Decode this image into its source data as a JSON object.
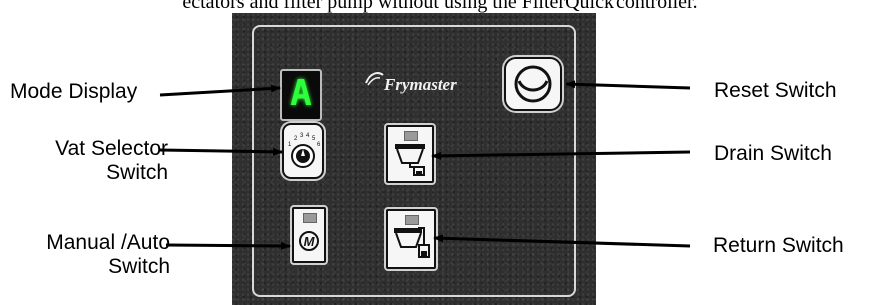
{
  "intro_text": {
    "prefix": "ectators and filter pump without using the FilterQuick",
    "suffix": "controller."
  },
  "panel": {
    "mode_display_value": "A",
    "brand": "Frymaster",
    "vat_selector_numbers": [
      "1",
      "2",
      "3",
      "4",
      "5",
      "6"
    ],
    "manual_symbol": "M"
  },
  "labels": {
    "mode_display": "Mode Display",
    "vat_selector_line1": "Vat Selector",
    "vat_selector_line2": "Switch",
    "manual_auto_line1": "Manual /Auto",
    "manual_auto_line2": "Switch",
    "reset_switch": "Reset Switch",
    "drain_switch": "Drain Switch",
    "return_switch": "Return Switch"
  },
  "colors": {
    "panel_background": "#2f2f2f",
    "display_digit": "#2cff3c",
    "button_face": "#f6f6f6",
    "arrow": "#000000"
  }
}
